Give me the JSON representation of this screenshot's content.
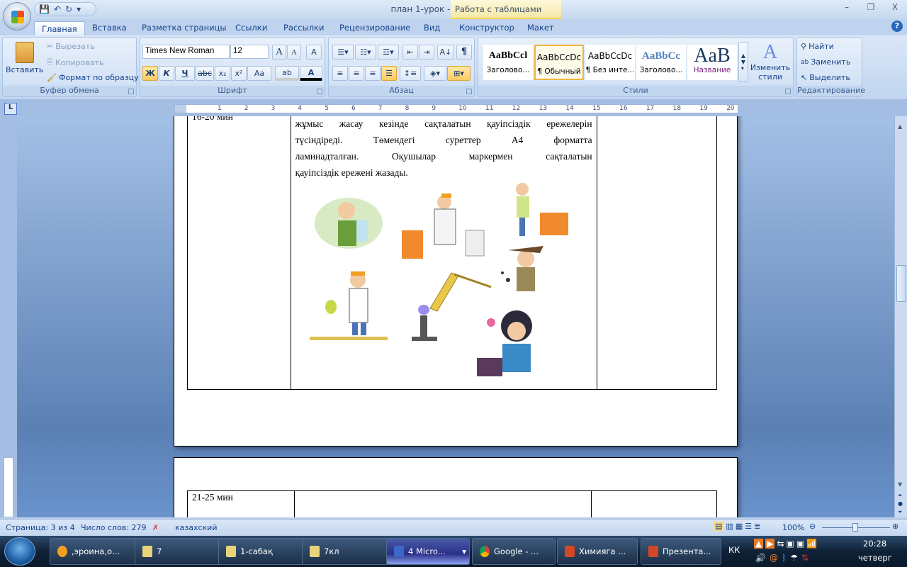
{
  "window": {
    "title": "план 1-урок - Microsoft Word",
    "context_tab": "Работа с таблицами",
    "minimize": "–",
    "restore": "❐",
    "close": "X"
  },
  "qat": {
    "save": "💾",
    "undo": "↶",
    "redo": "↻",
    "more": "▾"
  },
  "tabs": [
    "Главная",
    "Вставка",
    "Разметка страницы",
    "Ссылки",
    "Рассылки",
    "Рецензирование",
    "Вид",
    "Конструктор",
    "Макет"
  ],
  "help": "?",
  "ribbon": {
    "clipboard": {
      "label": "Буфер обмена",
      "paste": "Вставить",
      "cut": "Вырезать",
      "copy": "Копировать",
      "format_painter": "Формат по образцу"
    },
    "font": {
      "label": "Шрифт",
      "font_name": "Times New Roman",
      "font_size": "12",
      "grow": "A",
      "shrink": "A",
      "clear": "A",
      "bold": "Ж",
      "italic": "К",
      "underline": "Ч",
      "strike": "abc",
      "sub": "x₂",
      "sup": "x²",
      "case": "Aa",
      "highlight": "ab",
      "color": "A"
    },
    "paragraph": {
      "label": "Абзац",
      "pilcrow": "¶",
      "sort": "А↓"
    },
    "styles": {
      "label": "Стили",
      "items": [
        {
          "preview": "AaBbCcl",
          "name": "Заголово..."
        },
        {
          "preview": "AaBbCcDc",
          "name": "¶ Обычный"
        },
        {
          "preview": "AaBbCcDc",
          "name": "¶ Без инте..."
        },
        {
          "preview": "AaBbCc",
          "name": "Заголово..."
        },
        {
          "preview": "AaB",
          "name": "Название"
        }
      ],
      "change_styles": "Изменить стили"
    },
    "editing": {
      "label": "Редактирование",
      "find": "Найти",
      "replace": "Заменить",
      "select": "Выделить"
    }
  },
  "ruler": {
    "tab_selector": "L",
    "ticks": [
      "1",
      "2",
      "3",
      "4",
      "5",
      "6",
      "7",
      "8",
      "9",
      "10",
      "11",
      "12",
      "13",
      "14",
      "15",
      "16",
      "17",
      "18",
      "19",
      "20"
    ]
  },
  "document": {
    "row1": {
      "time": "16-20 мин",
      "lines": [
        "жұмыс жасау кезінде сақталатын қауіпсіздік ережелерін",
        "түсіндіреді. Төмендегі суреттер А4 форматта",
        "ламинадталған. Оқушылар маркермен сақталатын"
      ],
      "last_line": "қауіпсіздік ережені жазады."
    },
    "row2": {
      "time": "21-25 мин"
    }
  },
  "status": {
    "page": "Страница: 3 из 4",
    "words": "Число слов: 279",
    "language": "казахский",
    "zoom": "100%",
    "zoom_level_percent": 100
  },
  "taskbar": {
    "items": [
      ",эроина,о...",
      "7",
      "1-сабақ",
      "7кл",
      "4 Micro...",
      "Google - ...",
      "Химияга ...",
      "Презента..."
    ],
    "lang": "КК",
    "time": "20:28",
    "day": "четверг"
  },
  "colors": {
    "accent": "#15428b",
    "highlight": "#ffc960",
    "doc_bg": "#5b80b4"
  }
}
